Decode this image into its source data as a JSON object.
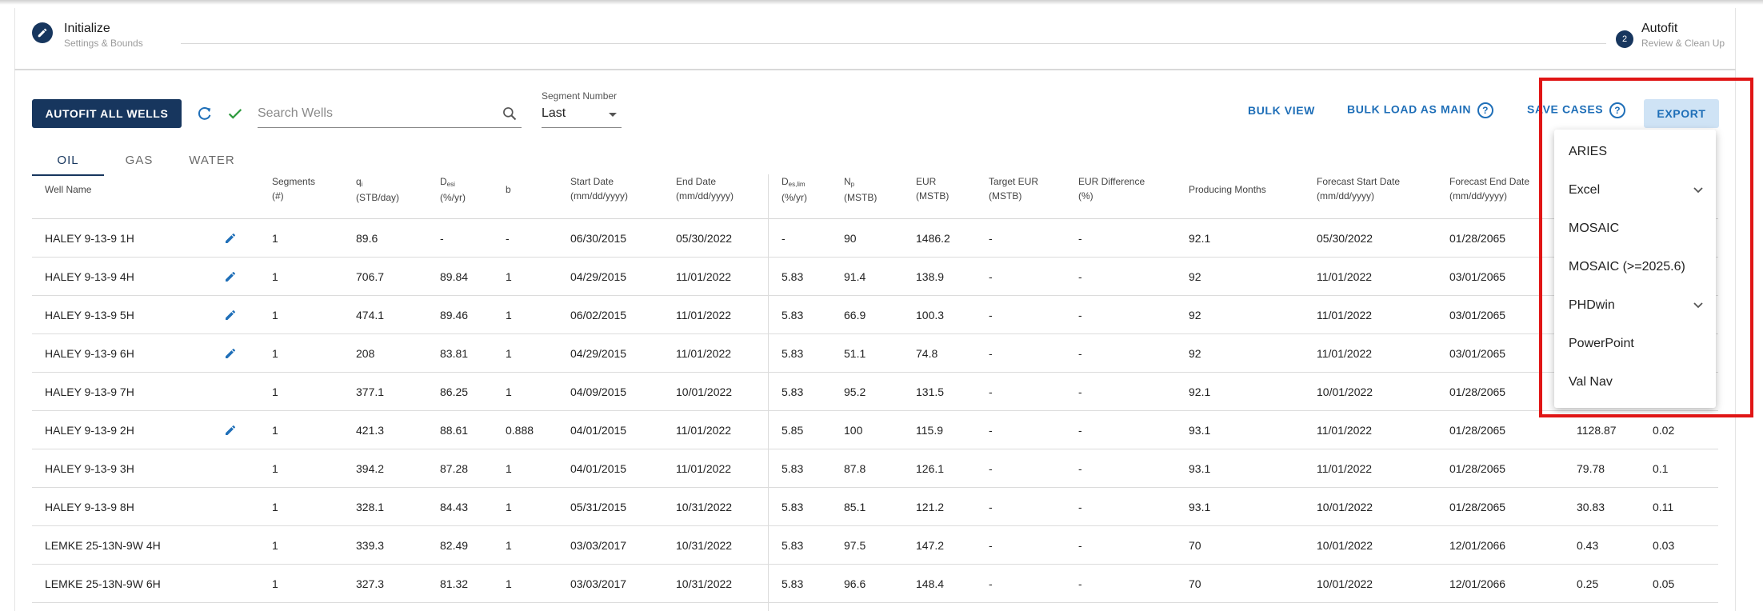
{
  "stepper": {
    "step1": {
      "title": "Initialize",
      "subtitle": "Settings & Bounds"
    },
    "step2": {
      "number": "2",
      "title": "Autofit",
      "subtitle": "Review & Clean Up"
    }
  },
  "toolbar": {
    "autofit_label": "AUTOFIT ALL WELLS",
    "search_placeholder": "Search Wells",
    "segment_label": "Segment Number",
    "segment_value": "Last",
    "bulk_view": "BULK VIEW",
    "bulk_load": "BULK LOAD AS MAIN",
    "save_cases": "SAVE CASES",
    "export": "EXPORT",
    "help_glyph": "?"
  },
  "tabs": [
    {
      "label": "OIL",
      "active": true
    },
    {
      "label": "GAS",
      "active": false
    },
    {
      "label": "WATER",
      "active": false
    }
  ],
  "columns": {
    "well": "Well Name",
    "segments": [
      "Segments",
      "(#)"
    ],
    "qi": [
      "q",
      "i",
      "(STB/day)"
    ],
    "desi": [
      "D",
      "esi",
      "(%/yr)"
    ],
    "b": "b",
    "start": [
      "Start Date",
      "(mm/dd/yyyy)"
    ],
    "end": [
      "End Date",
      "(mm/dd/yyyy)"
    ],
    "deslim": [
      "D",
      "es,lim",
      "(%/yr)"
    ],
    "np": [
      "N",
      "p",
      "(MSTB)"
    ],
    "eur": [
      "EUR",
      "(MSTB)"
    ],
    "target": [
      "Target EUR",
      "(MSTB)"
    ],
    "eurdiff": [
      "EUR Difference",
      "(%)"
    ],
    "months": "Producing Months",
    "fstart": [
      "Forecast Start Date",
      "(mm/dd/yyyy)"
    ],
    "fend": [
      "Forecast End Date",
      "(mm/dd/yyyy)"
    ]
  },
  "rows": [
    {
      "name": "HALEY 9-13-9 1H",
      "edited": true,
      "seg": "1",
      "qi": "89.6",
      "desi": "-",
      "b": "-",
      "start": "06/30/2015",
      "end": "05/30/2022",
      "deslim": "-",
      "np": "90",
      "eur": "1486.2",
      "target": "-",
      "diff": "-",
      "months": "92.1",
      "fstart": "05/30/2022",
      "fend": "01/28/2065",
      "c1": "",
      "c2": ""
    },
    {
      "name": "HALEY 9-13-9 4H",
      "edited": true,
      "seg": "1",
      "qi": "706.7",
      "desi": "89.84",
      "b": "1",
      "start": "04/29/2015",
      "end": "11/01/2022",
      "deslim": "5.83",
      "np": "91.4",
      "eur": "138.9",
      "target": "-",
      "diff": "-",
      "months": "92",
      "fstart": "11/01/2022",
      "fend": "03/01/2065",
      "c1": "",
      "c2": ""
    },
    {
      "name": "HALEY 9-13-9 5H",
      "edited": true,
      "seg": "1",
      "qi": "474.1",
      "desi": "89.46",
      "b": "1",
      "start": "06/02/2015",
      "end": "11/01/2022",
      "deslim": "5.83",
      "np": "66.9",
      "eur": "100.3",
      "target": "-",
      "diff": "-",
      "months": "92",
      "fstart": "11/01/2022",
      "fend": "03/01/2065",
      "c1": "",
      "c2": ""
    },
    {
      "name": "HALEY 9-13-9 6H",
      "edited": true,
      "seg": "1",
      "qi": "208",
      "desi": "83.81",
      "b": "1",
      "start": "04/29/2015",
      "end": "11/01/2022",
      "deslim": "5.83",
      "np": "51.1",
      "eur": "74.8",
      "target": "-",
      "diff": "-",
      "months": "92",
      "fstart": "11/01/2022",
      "fend": "03/01/2065",
      "c1": "",
      "c2": ""
    },
    {
      "name": "HALEY 9-13-9 7H",
      "edited": false,
      "seg": "1",
      "qi": "377.1",
      "desi": "86.25",
      "b": "1",
      "start": "04/09/2015",
      "end": "10/01/2022",
      "deslim": "5.83",
      "np": "95.2",
      "eur": "131.5",
      "target": "-",
      "diff": "-",
      "months": "92.1",
      "fstart": "10/01/2022",
      "fend": "01/28/2065",
      "c1": "",
      "c2": ""
    },
    {
      "name": "HALEY 9-13-9 2H",
      "edited": true,
      "seg": "1",
      "qi": "421.3",
      "desi": "88.61",
      "b": "0.888",
      "start": "04/01/2015",
      "end": "11/01/2022",
      "deslim": "5.85",
      "np": "100",
      "eur": "115.9",
      "target": "-",
      "diff": "-",
      "months": "93.1",
      "fstart": "11/01/2022",
      "fend": "01/28/2065",
      "c1": "1128.87",
      "c2": "0.02"
    },
    {
      "name": "HALEY 9-13-9 3H",
      "edited": false,
      "seg": "1",
      "qi": "394.2",
      "desi": "87.28",
      "b": "1",
      "start": "04/01/2015",
      "end": "11/01/2022",
      "deslim": "5.83",
      "np": "87.8",
      "eur": "126.1",
      "target": "-",
      "diff": "-",
      "months": "93.1",
      "fstart": "11/01/2022",
      "fend": "01/28/2065",
      "c1": "79.78",
      "c2": "0.1"
    },
    {
      "name": "HALEY 9-13-9 8H",
      "edited": false,
      "seg": "1",
      "qi": "328.1",
      "desi": "84.43",
      "b": "1",
      "start": "05/31/2015",
      "end": "10/31/2022",
      "deslim": "5.83",
      "np": "85.1",
      "eur": "121.2",
      "target": "-",
      "diff": "-",
      "months": "93.1",
      "fstart": "10/01/2022",
      "fend": "01/28/2065",
      "c1": "30.83",
      "c2": "0.11"
    },
    {
      "name": "LEMKE 25-13N-9W 4H",
      "edited": false,
      "seg": "1",
      "qi": "339.3",
      "desi": "82.49",
      "b": "1",
      "start": "03/03/2017",
      "end": "10/31/2022",
      "deslim": "5.83",
      "np": "97.5",
      "eur": "147.2",
      "target": "-",
      "diff": "-",
      "months": "70",
      "fstart": "10/01/2022",
      "fend": "12/01/2066",
      "c1": "0.43",
      "c2": "0.03"
    },
    {
      "name": "LEMKE 25-13N-9W 6H",
      "edited": false,
      "seg": "1",
      "qi": "327.3",
      "desi": "81.32",
      "b": "1",
      "start": "03/03/2017",
      "end": "10/31/2022",
      "deslim": "5.83",
      "np": "96.6",
      "eur": "148.4",
      "target": "-",
      "diff": "-",
      "months": "70",
      "fstart": "10/01/2022",
      "fend": "12/01/2066",
      "c1": "0.25",
      "c2": "0.05"
    }
  ],
  "export_menu": [
    {
      "label": "ARIES",
      "submenu": false
    },
    {
      "label": "Excel",
      "submenu": true
    },
    {
      "label": "MOSAIC",
      "submenu": false
    },
    {
      "label": "MOSAIC (>=2025.6)",
      "submenu": false
    },
    {
      "label": "PHDwin",
      "submenu": true
    },
    {
      "label": "PowerPoint",
      "submenu": false
    },
    {
      "label": "Val Nav",
      "submenu": false
    }
  ],
  "colors": {
    "primary": "#17365e",
    "accent": "#1f6fb8",
    "highlight": "#e01515",
    "success": "#2e9a3e"
  }
}
